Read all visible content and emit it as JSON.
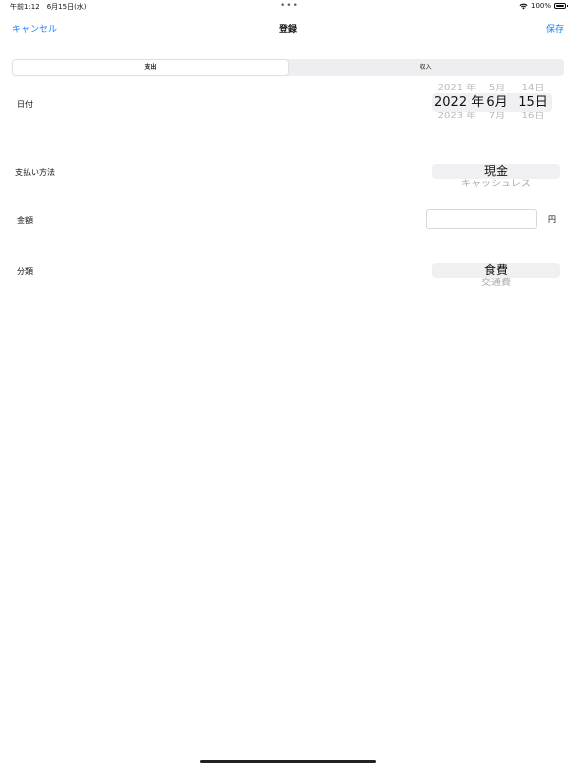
{
  "status_bar": {
    "time": "午前1:12　6月15日(水)",
    "dots": "•••",
    "battery": "100%"
  },
  "nav": {
    "cancel": "キャンセル",
    "title": "登録",
    "save": "保存"
  },
  "segments": [
    "支出",
    "収入"
  ],
  "form": {
    "date_label": "日付",
    "payment_label": "支払い方法",
    "amount_label": "金額",
    "category_label": "分類"
  },
  "date_picker": {
    "year": {
      "prev": "2021 年",
      "selected": "2022 年",
      "next": "2023 年"
    },
    "month": {
      "prev": "5月",
      "selected": "6月",
      "next": "7月"
    },
    "day": {
      "prev": "14日",
      "selected": "15日",
      "next": "16日"
    }
  },
  "payment_picker": {
    "selected": "現金",
    "next": "キャッシュレス"
  },
  "amount": {
    "value": "",
    "unit": "円"
  },
  "category_picker": {
    "selected": "食費",
    "next": "交通費"
  },
  "colors": {
    "accent": "#1a82ff"
  }
}
